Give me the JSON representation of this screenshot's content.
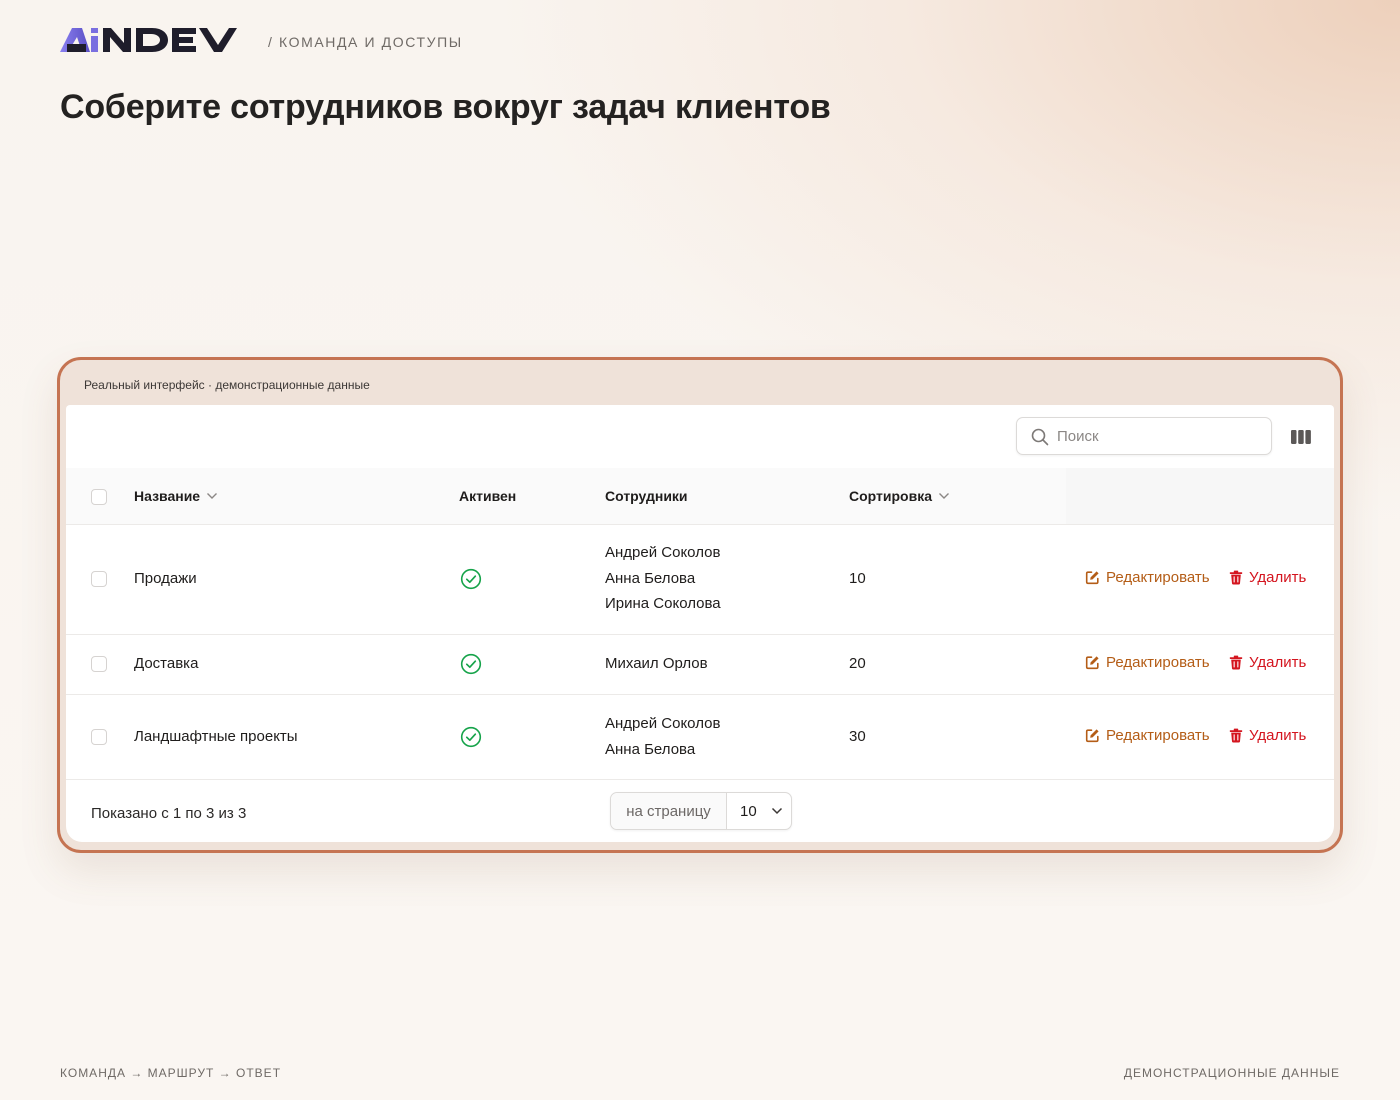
{
  "brand": {
    "logo_text": "AiNDEV"
  },
  "header": {
    "breadcrumb": "/ КОМАНДА И ДОСТУПЫ",
    "title": "Соберите сотрудников вокруг задач клиентов"
  },
  "demo": {
    "caption": "Реальный интерфейс · демонстрационные данные",
    "search": {
      "placeholder": "Поиск",
      "value": ""
    },
    "columns": {
      "name": "Название",
      "active": "Активен",
      "members": "Сотрудники",
      "sort": "Сортировка"
    },
    "rows": [
      {
        "name": "Продажи",
        "active": true,
        "members": [
          "Андрей Соколов",
          "Анна Белова",
          "Ирина Соколова"
        ],
        "sort": "10",
        "edit": "Редактировать",
        "delete": "Удалить"
      },
      {
        "name": "Доставка",
        "active": true,
        "members": [
          "Михаил Орлов"
        ],
        "sort": "20",
        "edit": "Редактировать",
        "delete": "Удалить"
      },
      {
        "name": "Ландшафтные проекты",
        "active": true,
        "members": [
          "Андрей Соколов",
          "Анна Белова"
        ],
        "sort": "30",
        "edit": "Редактировать",
        "delete": "Удалить"
      }
    ],
    "pagination": {
      "shown": "Показано с 1 по 3 из 3",
      "per_page_label": "на страницу",
      "per_page_value": "10"
    }
  },
  "footer": {
    "left": "КОМАНДА → МАРШРУТ → ОТВЕТ",
    "right": "ДЕМОНСТРАЦИОННЫЕ ДАННЫЕ"
  },
  "colors": {
    "accent_frame": "#c57452",
    "edit": "#b45d17",
    "delete": "#d4151f",
    "active_check": "#16a34a",
    "logo_purple": "#6b5fd3",
    "logo_dark": "#1f1d2b"
  },
  "icons": {
    "search": "search-icon",
    "columns": "columns-icon",
    "sort": "chevron-down-icon",
    "active": "check-circle-icon",
    "edit": "edit-icon",
    "delete": "trash-icon"
  }
}
